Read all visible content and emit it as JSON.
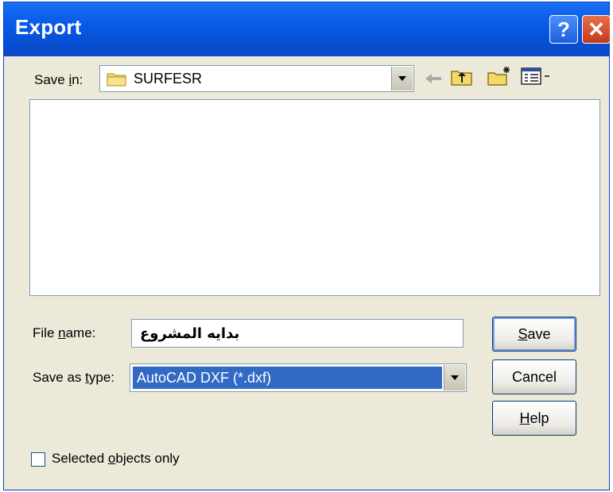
{
  "window": {
    "title": "Export"
  },
  "title_buttons": {
    "help_glyph": "?",
    "close_glyph": "✕"
  },
  "save_in": {
    "label_pre": "Save ",
    "label_key": "i",
    "label_post": "n:",
    "value": "SURFESR"
  },
  "toolbar": {
    "icons": [
      "back-arrow-icon",
      "up-folder-icon",
      "new-folder-icon",
      "view-menu-icon"
    ]
  },
  "file_name": {
    "label_pre": "File ",
    "label_key": "n",
    "label_post": "ame:",
    "value": "بدايه المشروع"
  },
  "save_as_type": {
    "label_pre": "Save as ",
    "label_key": "t",
    "label_post": "ype:",
    "value": "AutoCAD DXF (*.dxf)"
  },
  "buttons": {
    "save": {
      "key": "S",
      "rest": "ave"
    },
    "cancel": {
      "label": "Cancel"
    },
    "help": {
      "key": "H",
      "rest": "elp"
    }
  },
  "checkbox": {
    "label_pre": "Selected ",
    "label_key": "o",
    "label_post": "bjects only",
    "checked": false
  },
  "colors": {
    "titlebar": "#0a5cea",
    "dialog_bg": "#ece9d8",
    "selection": "#316ac5"
  }
}
